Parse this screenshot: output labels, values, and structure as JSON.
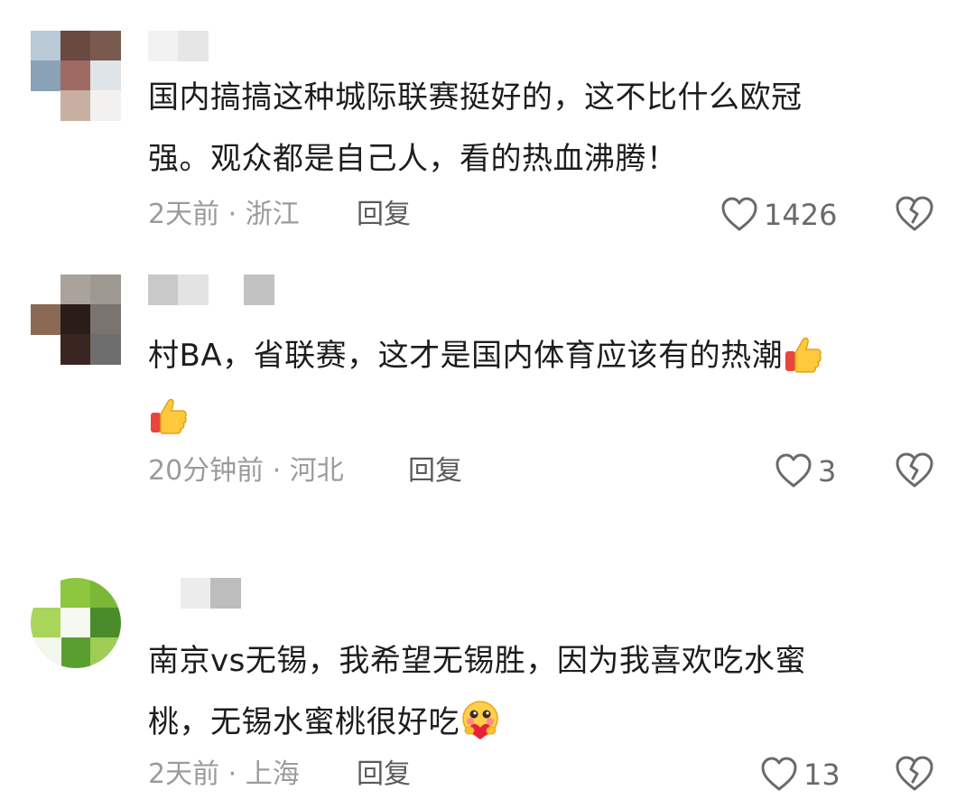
{
  "comments": [
    {
      "text": "国内搞搞这种城际联赛挺好的，这不比什么欧冠强。观众都是自己人，看的热血沸腾！",
      "line1": "国内搞搞这种城际联赛挺好的，这不比什么欧冠",
      "line2": "强。观众都是自己人，看的热血沸腾！",
      "meta": "2天前 · 浙江",
      "reply_label": "回复",
      "likes": "1426"
    },
    {
      "text": "村BA，省联赛，这才是国内体育应该有的热潮👍👍",
      "line1": "村BA，省联赛，这才是国内体育应该有的热潮",
      "meta": "20分钟前 · 河北",
      "reply_label": "回复",
      "likes": "3",
      "emojis": [
        "thumbs-up",
        "thumbs-up"
      ]
    },
    {
      "text": "南京vs无锡，我希望无锡胜，因为我喜欢吃水蜜桃，无锡水蜜桃很好吃🥰",
      "line1": "南京vs无锡，我希望无锡胜，因为我喜欢吃水蜜",
      "line2": "桃，无锡水蜜桃很好吃",
      "meta": "2天前 · 上海",
      "reply_label": "回复",
      "likes": "13",
      "emojis": [
        "hugging-heart-face"
      ]
    }
  ],
  "icons": {
    "like": "heart-outline-icon",
    "dislike": "broken-heart-icon",
    "avatar": "blurred-avatar"
  },
  "colors": {
    "text": "#1d1d1d",
    "meta": "#9b9b9b",
    "reply": "#5a5a5a",
    "icon": "#6a6a6a"
  }
}
